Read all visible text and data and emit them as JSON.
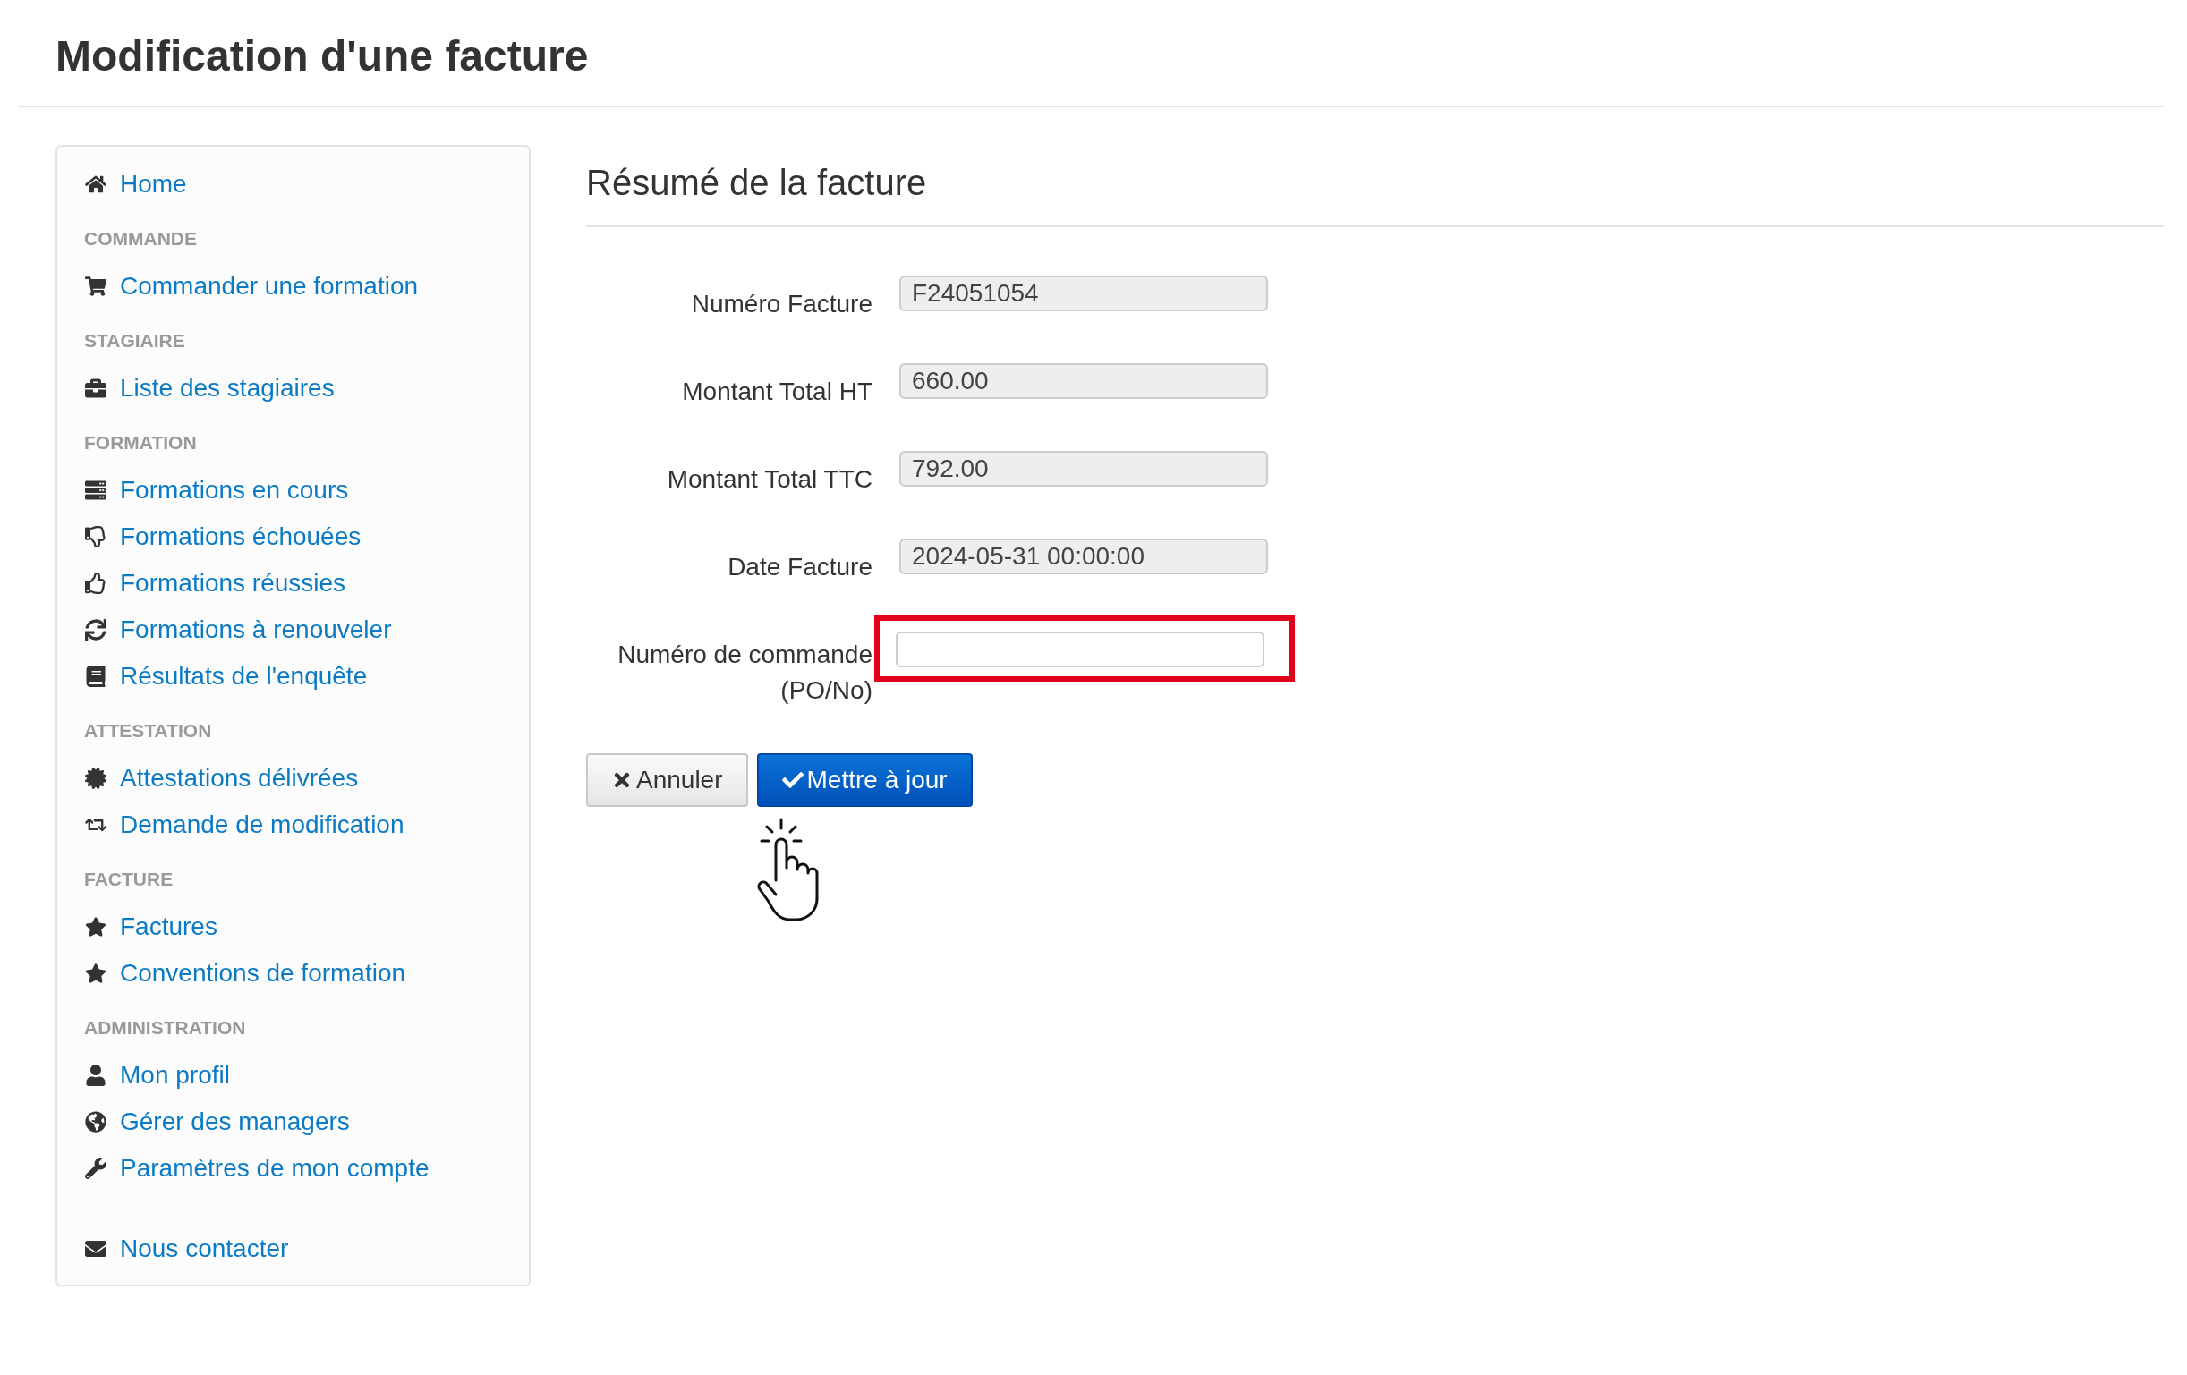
{
  "page_title": "Modification d'une facture",
  "sidebar": {
    "groups": [
      {
        "items": [
          {
            "label": "Home"
          }
        ]
      },
      {
        "heading": "COMMANDE",
        "items": [
          {
            "label": "Commander une formation"
          }
        ]
      },
      {
        "heading": "STAGIAIRE",
        "items": [
          {
            "label": "Liste des stagiaires"
          }
        ]
      },
      {
        "heading": "FORMATION",
        "items": [
          {
            "label": "Formations en cours"
          },
          {
            "label": "Formations échouées"
          },
          {
            "label": "Formations réussies"
          },
          {
            "label": "Formations à renouveler"
          },
          {
            "label": "Résultats de l'enquête"
          }
        ]
      },
      {
        "heading": "ATTESTATION",
        "items": [
          {
            "label": "Attestations délivrées"
          },
          {
            "label": "Demande de modification"
          }
        ]
      },
      {
        "heading": "FACTURE",
        "items": [
          {
            "label": "Factures"
          },
          {
            "label": "Conventions de formation"
          }
        ]
      },
      {
        "heading": "ADMINISTRATION",
        "items": [
          {
            "label": "Mon profil"
          },
          {
            "label": "Gérer des managers"
          },
          {
            "label": "Paramètres de mon compte"
          }
        ]
      },
      {
        "items": [
          {
            "label": "Nous contacter"
          }
        ]
      }
    ]
  },
  "section_title": "Résumé de la facture",
  "form": {
    "fields": [
      {
        "label": "Numéro Facture",
        "value": "F24051054",
        "disabled": true,
        "highlighted": false
      },
      {
        "label": "Montant Total HT",
        "value": "660.00",
        "disabled": true,
        "highlighted": false
      },
      {
        "label": "Montant Total TTC",
        "value": "792.00",
        "disabled": true,
        "highlighted": false
      },
      {
        "label": "Date Facture",
        "value": "2024-05-31 00:00:00",
        "disabled": true,
        "highlighted": false
      },
      {
        "label": "Numéro de commande (PO/No)",
        "disabled": false,
        "highlighted": true
      }
    ]
  },
  "buttons": [
    {
      "kind": "cancel",
      "label": "Annuler"
    },
    {
      "kind": "primary",
      "label": "Mettre à jour"
    }
  ]
}
